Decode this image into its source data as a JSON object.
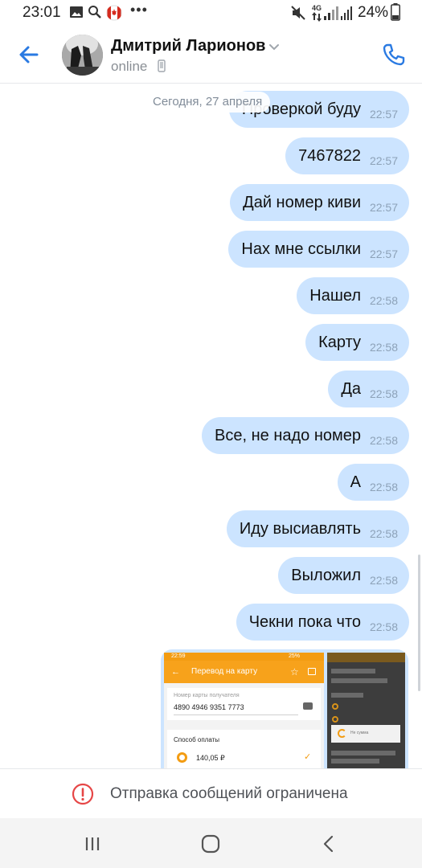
{
  "status_bar": {
    "time": "23:01",
    "battery": "24%",
    "network": "4G",
    "icons": [
      "image-icon",
      "search-icon",
      "canada-flag-icon",
      "more-dots-icon",
      "mute-icon",
      "signal-icon",
      "battery-icon"
    ]
  },
  "header": {
    "contact_name": "Дмитрий Ларионов",
    "status": "online",
    "icons": [
      "back-arrow-icon",
      "chevron-down-icon",
      "mobile-phone-icon",
      "call-icon"
    ]
  },
  "chat": {
    "date": "Сегодня, 27 апреля",
    "bubble_color": "#cce4ff",
    "messages": [
      {
        "text": "Проверкой буду",
        "time": "22:57"
      },
      {
        "text": "7467822",
        "time": "22:57"
      },
      {
        "text": "Дай номер киви",
        "time": "22:57"
      },
      {
        "text": "Нах мне ссылки",
        "time": "22:57"
      },
      {
        "text": "Нашел",
        "time": "22:58"
      },
      {
        "text": "Карту",
        "time": "22:58"
      },
      {
        "text": "Да",
        "time": "22:58"
      },
      {
        "text": "Все, не надо номер",
        "time": "22:58"
      },
      {
        "text": "А",
        "time": "22:58"
      },
      {
        "text": "Иду высиавлять",
        "time": "22:58"
      },
      {
        "text": "Выложил",
        "time": "22:58"
      },
      {
        "text": "Чекни пока что",
        "time": "22:58"
      }
    ],
    "attachment": {
      "screenshot1": {
        "status_time": "22:59",
        "status_battery": "25%",
        "title": "Перевод на карту",
        "card_label": "Номер карты получателя",
        "card_number": "4890 4946 9351 7773",
        "payment_label": "Способ оплаты",
        "amount": "140,05 ₽"
      },
      "screenshot2": {
        "dialog_text": "Не сумма"
      }
    }
  },
  "restriction": {
    "text": "Отправка сообщений ограничена",
    "color": "#e64646"
  },
  "navbar": {
    "buttons": [
      "recent-apps-icon",
      "home-icon",
      "back-icon"
    ]
  },
  "accent": "#2a7ae2"
}
